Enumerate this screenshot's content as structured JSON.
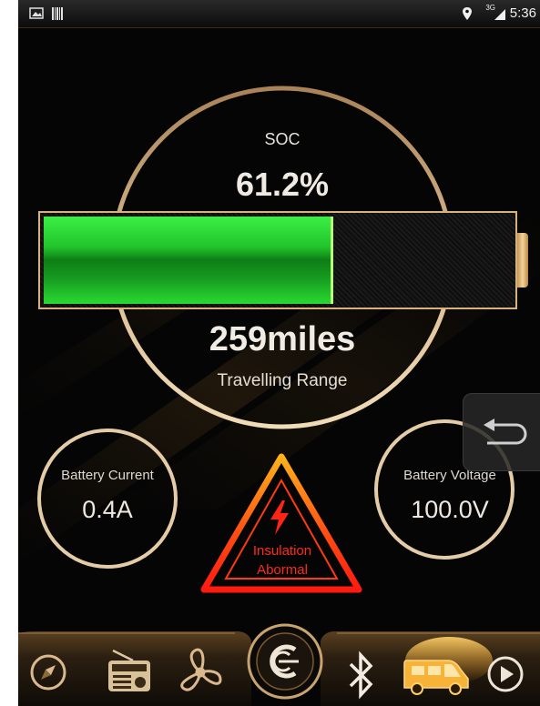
{
  "status_bar": {
    "time": "5:36",
    "network": "3G",
    "icons": [
      "gallery-icon",
      "barcode-icon",
      "location-pin-icon",
      "signal-icon"
    ]
  },
  "soc": {
    "label": "SOC",
    "value": "61.2%",
    "level": 0.612
  },
  "range": {
    "value": "259miles",
    "label": "Travelling Range"
  },
  "battery_current": {
    "label": "Battery Current",
    "value": "0.4A"
  },
  "battery_voltage": {
    "label": "Battery Voltage",
    "value": "100.0V"
  },
  "warning": {
    "line1": "Insulation",
    "line2": "Abormal",
    "icon": "lightning-icon"
  },
  "nav": {
    "items": [
      "compass-icon",
      "radio-icon",
      "fan-icon",
      "brand-logo-icon",
      "bluetooth-icon",
      "van-icon",
      "play-icon"
    ],
    "active": "van-icon"
  },
  "colors": {
    "accent_gold": "#d8b27e",
    "battery_green": "#2ad932",
    "warning_red": "#ff2a1a",
    "warning_orange": "#ff7a1a"
  }
}
